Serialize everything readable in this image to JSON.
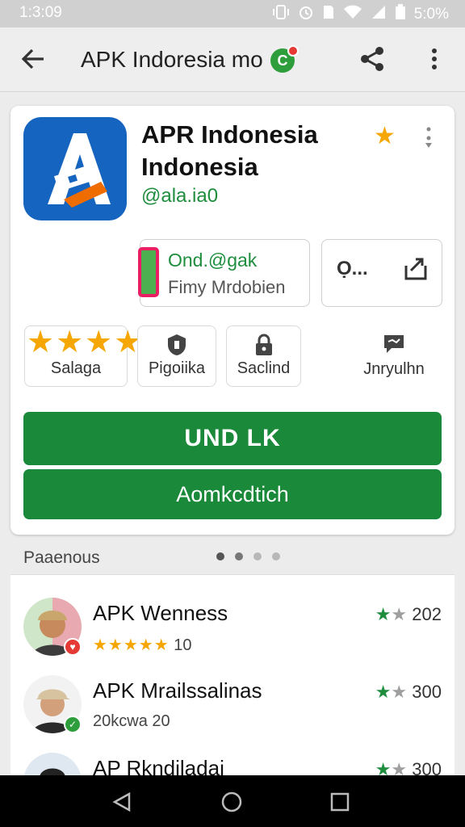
{
  "status_bar": {
    "time": "1:3:09",
    "battery": "5:0%",
    "icons": [
      "vibrate-icon",
      "alarm-icon",
      "sim-icon",
      "wifi-icon",
      "signal-icon",
      "battery-icon"
    ]
  },
  "toolbar": {
    "title": "APK Indoresia mo",
    "badge": "C"
  },
  "app": {
    "name": "APR Indonesia Indonesia",
    "developer": "@ala.ia0",
    "primary_chip": {
      "line1": "Ond.@gak",
      "line2": "Fimy Mrdobien"
    },
    "secondary_chip": {
      "label": "Ọ..."
    },
    "stats": [
      {
        "label": "Salaga",
        "icon": "star-rating"
      },
      {
        "label": "Pigoiika",
        "icon": "shield-icon"
      },
      {
        "label": "Saclind",
        "icon": "lock-icon"
      },
      {
        "label": "Jnryulhn",
        "icon": "chat-icon"
      }
    ],
    "rating_stars": "★★★★",
    "install_label": "UND LK",
    "open_label": "Aomkcdtich"
  },
  "section": {
    "title": "Paaenous",
    "pages": 4,
    "active_page": 1
  },
  "list": [
    {
      "name": "APK Wenness",
      "stars": "★★★★★",
      "sub": "10",
      "rating": "202",
      "badge_color": "#e53935"
    },
    {
      "name": "APK Mrailssalinas",
      "stars": "",
      "sub": "20kcwa 20",
      "rating": "300",
      "badge_color": "#2e9e3c"
    },
    {
      "name": "AP Rkndiladai",
      "stars": "",
      "sub": "",
      "rating": "300",
      "badge_color": "#1e88e5"
    }
  ],
  "colors": {
    "accent": "#1a8a3a",
    "star": "#f6a600",
    "app_icon_bg": "#1565c0"
  }
}
